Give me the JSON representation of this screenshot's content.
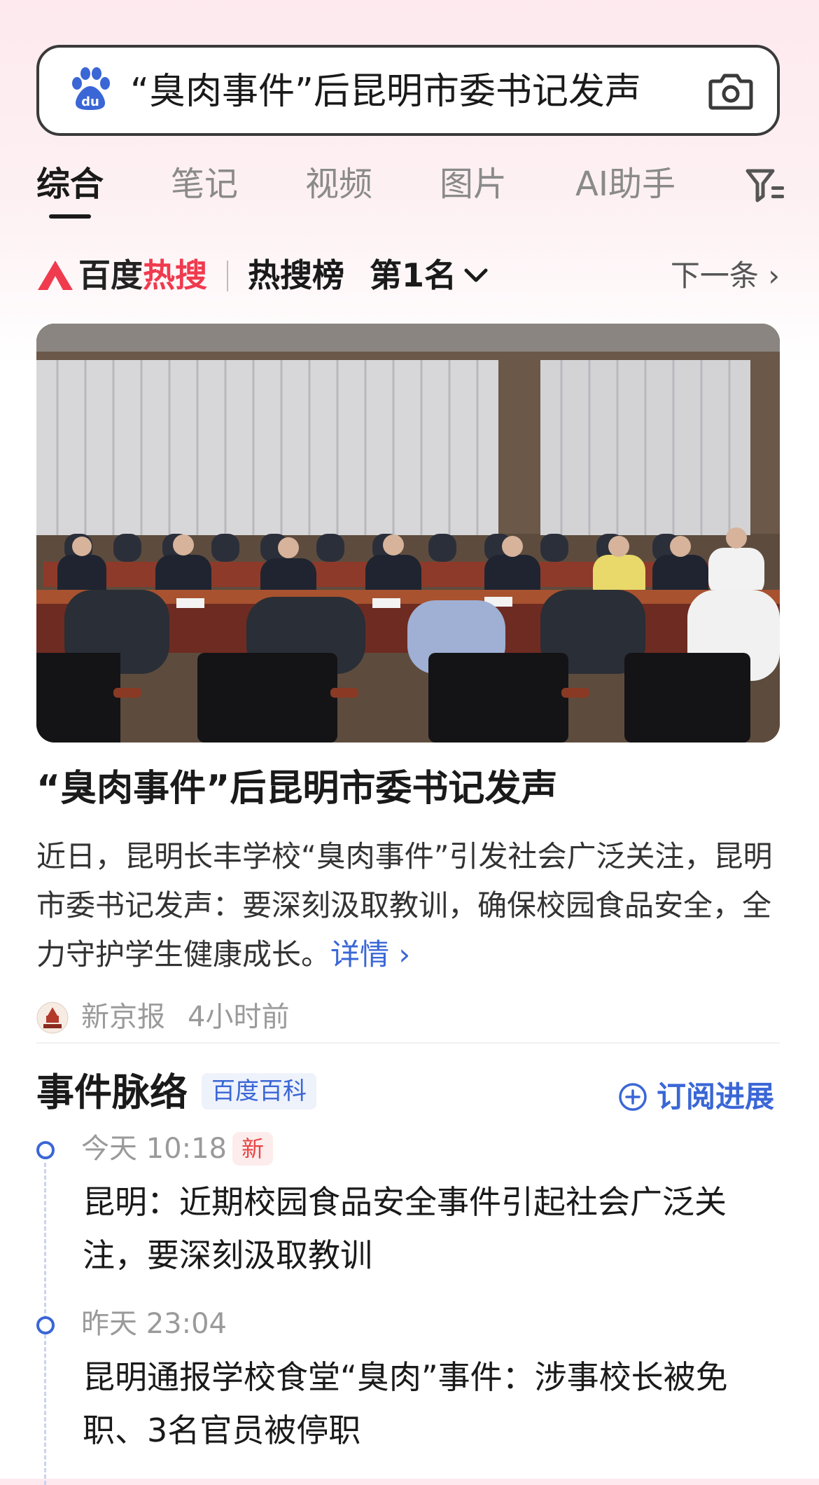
{
  "search": {
    "query": "“臭肉事件”后昆明市委书记发声"
  },
  "tabs": [
    {
      "label": "综合",
      "active": true
    },
    {
      "label": "笔记",
      "active": false
    },
    {
      "label": "视频",
      "active": false
    },
    {
      "label": "图片",
      "active": false
    },
    {
      "label": "AI助手",
      "active": false
    }
  ],
  "hot": {
    "brand_black": "百度",
    "brand_red": "热搜",
    "list_label": "热搜榜",
    "rank_label": "第1名",
    "next_label": "下一条 ›"
  },
  "article": {
    "headline": "“臭肉事件”后昆明市委书记发声",
    "summary": "近日，昆明长丰学校“臭肉事件”引发社会广泛关注，昆明市委书记发声：要深刻汲取教训，确保校园食品安全，全力守护学生健康成长。",
    "more_label": "详情 ›",
    "source_name": "新京报",
    "source_time": "4小时前"
  },
  "timeline": {
    "title": "事件脉络",
    "badge": "百度百科",
    "subscribe_label": "订阅进展",
    "items": [
      {
        "time": "今天 10:18",
        "badge": "新",
        "text": "昆明：近期校园食品安全事件引起社会广泛关注，要深刻汲取教训"
      },
      {
        "time": "昨天 23:04",
        "badge": "",
        "text": "昆明通报学校食堂“臭肉”事件：涉事校长被免职、3名官员被停职"
      }
    ]
  },
  "colors": {
    "accent_blue": "#3a66d6",
    "hot_red": "#f03a4e",
    "new_badge_red": "#e84545"
  },
  "icons": [
    "baidu-paw-icon",
    "camera-icon",
    "filter-icon",
    "hot-search-logo-icon",
    "chevron-down-icon",
    "plus-circle-icon",
    "newspaper-logo-icon"
  ]
}
